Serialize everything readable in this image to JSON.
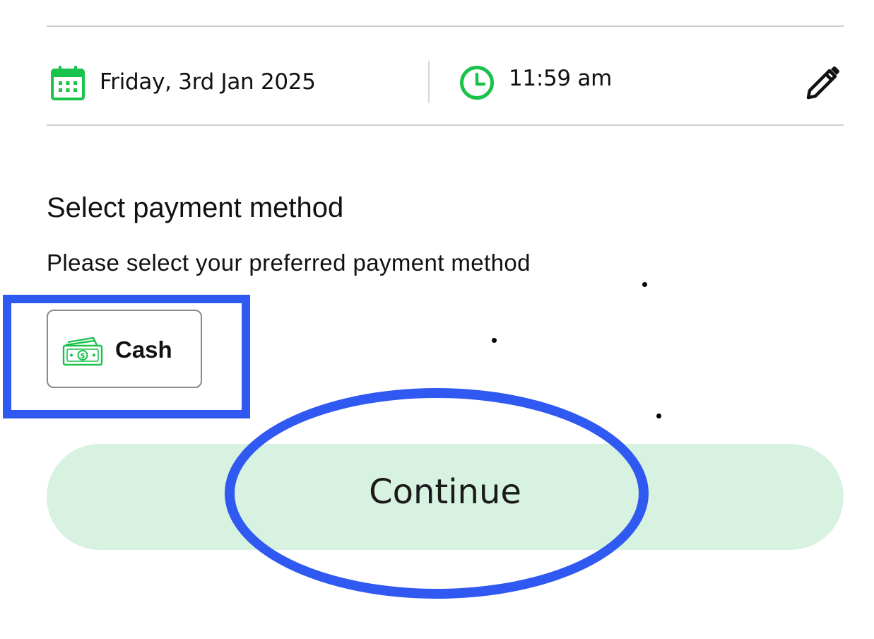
{
  "schedule": {
    "date": "Friday, 3rd Jan 2025",
    "time": "11:59 am",
    "icons": {
      "date": "calendar-icon",
      "time": "clock-icon",
      "edit": "pencil-icon"
    }
  },
  "payment": {
    "title": "Select payment method",
    "subtitle": "Please select your preferred payment method",
    "options": [
      {
        "label": "Cash",
        "icon": "cash-icon"
      }
    ]
  },
  "actions": {
    "continue_label": "Continue"
  },
  "colors": {
    "accent_green": "#19c24a",
    "button_bg": "#d7f2e1",
    "annotation_blue": "#2f59f0",
    "divider": "#cfcfcf"
  }
}
